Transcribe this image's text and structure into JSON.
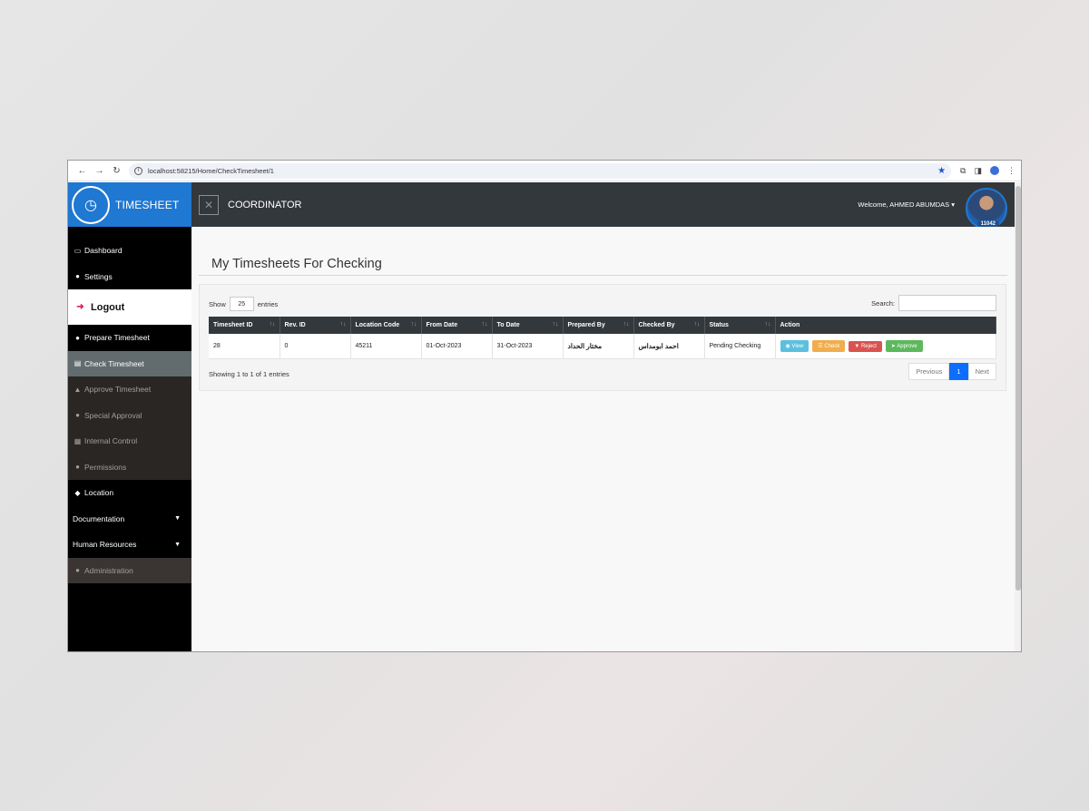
{
  "browser": {
    "url": "localhost:58215/Home/CheckTimesheet/1"
  },
  "brand": {
    "title": "TIMESHEET"
  },
  "topbar": {
    "role": "COORDINATOR",
    "welcome": "Welcome, AHMED ABUMDAS",
    "user_badge": "11042"
  },
  "sidebar": {
    "items": [
      {
        "label": "Dashboard",
        "icon": "monitor-icon"
      },
      {
        "label": "Settings",
        "icon": "user-gear-icon"
      },
      {
        "label": "Logout",
        "icon": "sign-out-icon"
      },
      {
        "label": "Prepare Timesheet",
        "icon": "user-gear-icon"
      },
      {
        "label": "Check Timesheet",
        "icon": "clipboard-check-icon"
      },
      {
        "label": "Approve Timesheet",
        "icon": "thumbs-up-icon"
      },
      {
        "label": "Special Approval",
        "icon": "user-gear-icon"
      },
      {
        "label": "Internal Control",
        "icon": "card-icon"
      },
      {
        "label": "Permissions",
        "icon": "user-lock-icon"
      },
      {
        "label": "Location",
        "icon": "map-icon"
      },
      {
        "label": "Documentation",
        "icon": "caret-down-icon"
      },
      {
        "label": "Human Resources",
        "icon": "caret-down-icon"
      },
      {
        "label": "Administration",
        "icon": "user-gear-icon"
      }
    ]
  },
  "main": {
    "title": "My Timesheets For Checking",
    "show_label": "Show",
    "entries_value": "25",
    "entries_label": "entries",
    "search_label": "Search:",
    "columns": [
      "Timesheet ID",
      "Rev. ID",
      "Location Code",
      "From Date",
      "To Date",
      "Prepared By",
      "Checked By",
      "Status",
      "Action"
    ],
    "rows": [
      {
        "timesheet_id": "28",
        "rev_id": "0",
        "location_code": "45211",
        "from_date": "01-Oct-2023",
        "to_date": "31-Oct-2023",
        "prepared_by": "مختار الحداد",
        "checked_by": "احمد ابومداس",
        "status": "Pending Checking",
        "actions": [
          "View",
          "Check",
          "Reject",
          "Approve"
        ]
      }
    ],
    "info": "Showing 1 to 1 of 1 entries",
    "pager": {
      "previous": "Previous",
      "current": "1",
      "next": "Next"
    }
  }
}
